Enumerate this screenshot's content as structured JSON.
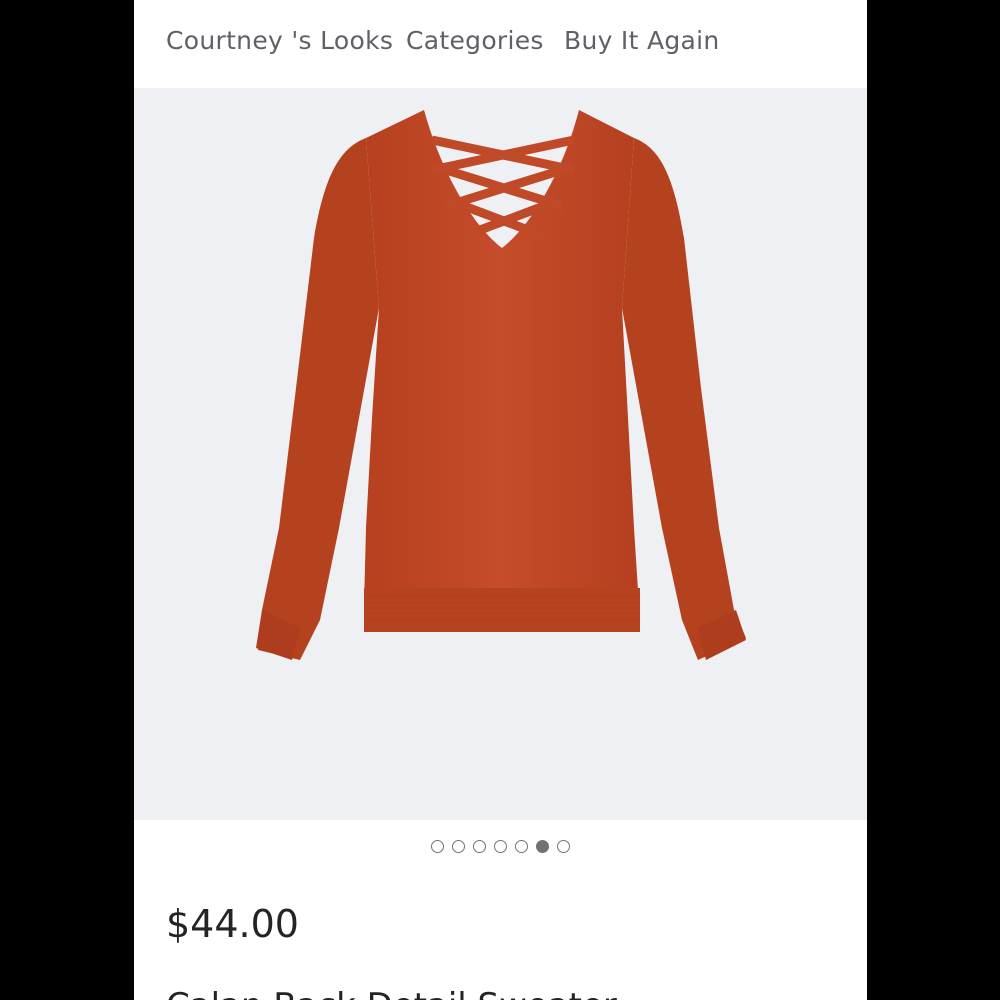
{
  "nav": {
    "items": [
      {
        "label": "Courtney 's Looks"
      },
      {
        "label": "Categories"
      },
      {
        "label": "Buy It Again"
      }
    ]
  },
  "product": {
    "image": {
      "description_icon": "sweater-image",
      "background_color": "#eef0f3",
      "garment_color": "#c24a2a"
    },
    "carousel": {
      "total": 7,
      "active_index": 5
    },
    "price": "$44.00",
    "name": "Calan Back Detail Sweater"
  },
  "colors": {
    "nav_text": "#5f6166",
    "price_text": "#222426",
    "dot": "#6f7378"
  }
}
